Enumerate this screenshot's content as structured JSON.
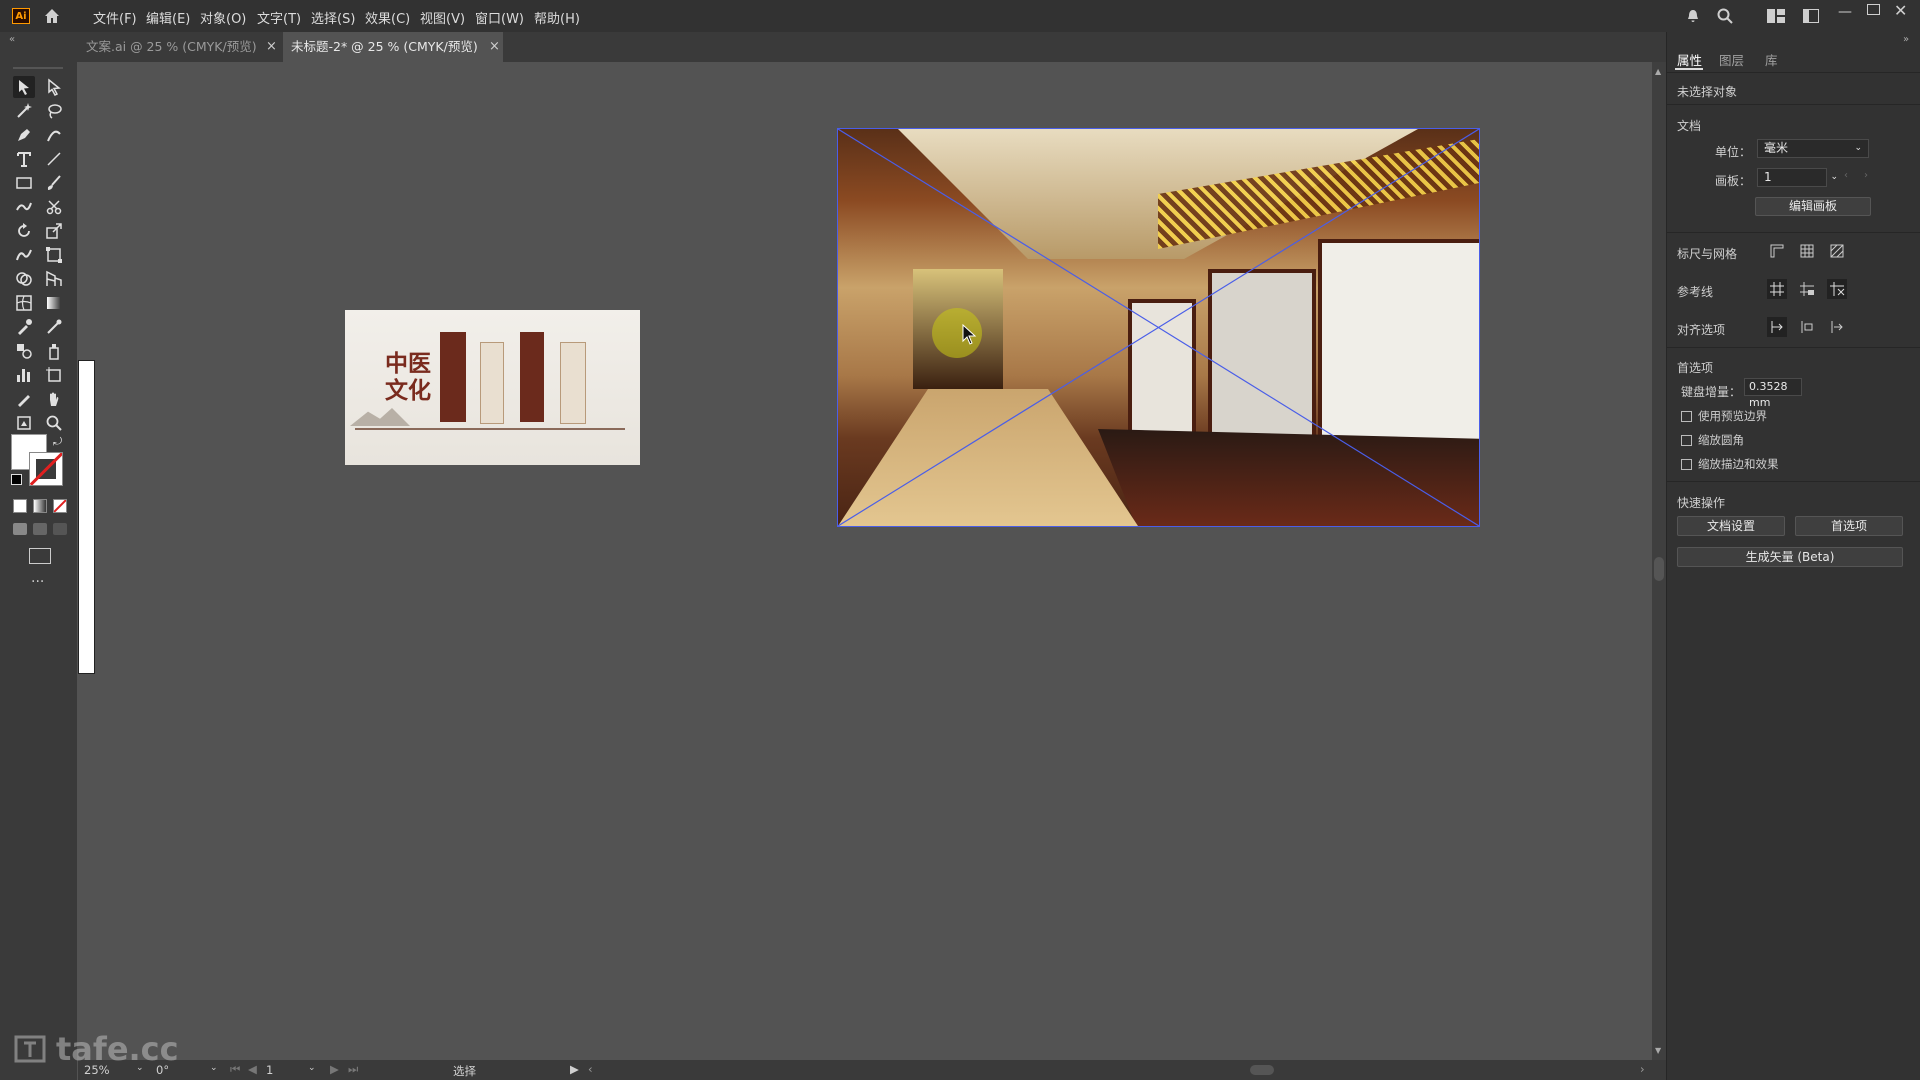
{
  "app": {
    "logo": "Ai"
  },
  "menu": [
    "文件(F)",
    "编辑(E)",
    "对象(O)",
    "文字(T)",
    "选择(S)",
    "效果(C)",
    "视图(V)",
    "窗口(W)",
    "帮助(H)"
  ],
  "tabs": [
    {
      "label": "文案.ai @ 25 % (CMYK/预览)",
      "active": false
    },
    {
      "label": "未标题-2* @ 25 % (CMYK/预览)",
      "active": true
    }
  ],
  "tab_close": "×",
  "panel": {
    "tabs": [
      "属性",
      "图层",
      "库"
    ],
    "no_selection": "未选择对象",
    "document_section": "文档",
    "units_label": "单位：",
    "units_value": "毫米",
    "artboard_label": "画板：",
    "artboard_value": "1",
    "edit_artboards": "编辑画板",
    "rulers_grids": "标尺与网格",
    "guides": "参考线",
    "snap_options": "对齐选项",
    "preferences": "首选项",
    "keyboard_increment_label": "键盘增量：",
    "keyboard_increment_value": "0.3528 mm",
    "use_preview_bounds": "使用预览边界",
    "scale_corners": "缩放圆角",
    "scale_strokes_effects": "缩放描边和效果",
    "quick_actions": "快速操作",
    "document_setup": "文档设置",
    "preferences_button": "首选项",
    "generate_vectors": "生成矢量 (Beta)"
  },
  "artwork": {
    "image1_label": "中医文化"
  },
  "status": {
    "zoom": "25%",
    "rotation": "0°",
    "artboard": "1",
    "tool": "选择"
  },
  "watermark": "tafe.cc"
}
